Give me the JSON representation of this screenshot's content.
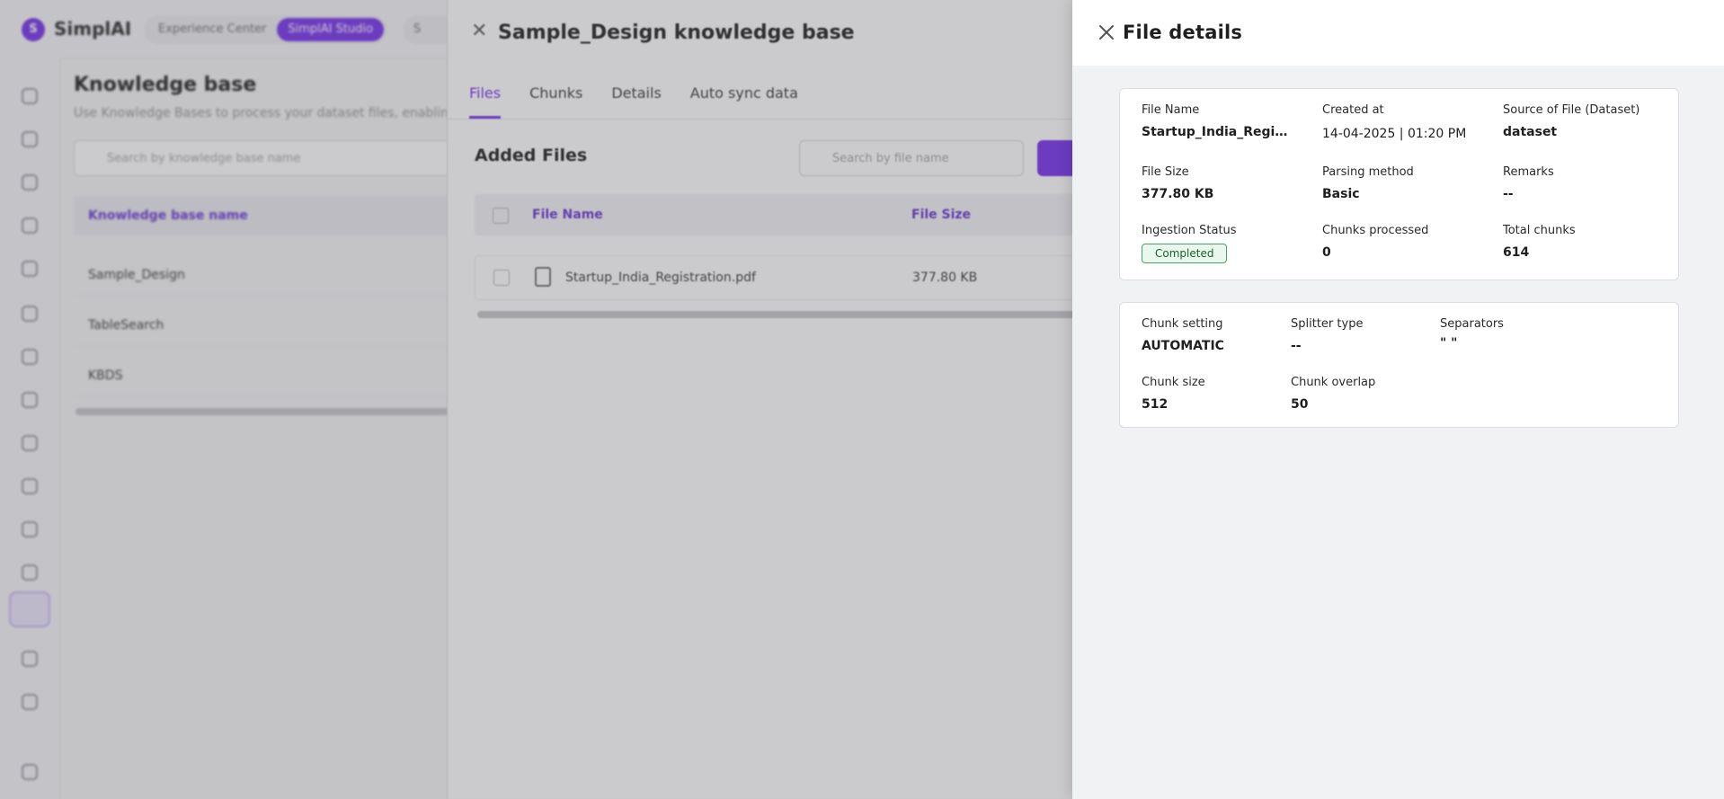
{
  "app": {
    "name": "SimplAI",
    "logo_letter": "S",
    "mode_tabs": [
      "Experience Center",
      "SimplAI Studio"
    ],
    "top_extra": "S"
  },
  "knowledge_base": {
    "title": "Knowledge base",
    "subtitle": "Use Knowledge Bases to process your dataset files, enabling sem",
    "search_placeholder": "Search by knowledge base name",
    "column_header": "Knowledge base name",
    "rows": [
      "Sample_Design",
      "TableSearch",
      "KBDS"
    ]
  },
  "kb_drawer": {
    "title": "Sample_Design knowledge base",
    "tabs": [
      "Files",
      "Chunks",
      "Details",
      "Auto sync data"
    ],
    "active_tab": "Files",
    "section_title": "Added Files",
    "search_placeholder": "Search by file name",
    "columns": [
      "File Name",
      "File Size"
    ],
    "files": [
      {
        "name": "Startup_India_Registration.pdf",
        "size": "377.80 KB"
      }
    ]
  },
  "file_details": {
    "title": "File details",
    "info": {
      "file_name_label": "File Name",
      "file_name": "Startup_India_Registrat...",
      "created_at_label": "Created at",
      "created_at": "14-04-2025 | 01:20 PM",
      "source_label": "Source of File (Dataset)",
      "source": "dataset",
      "file_size_label": "File Size",
      "file_size": "377.80 KB",
      "parsing_method_label": "Parsing method",
      "parsing_method": "Basic",
      "remarks_label": "Remarks",
      "remarks": "--",
      "ingestion_status_label": "Ingestion Status",
      "ingestion_status": "Completed",
      "chunks_processed_label": "Chunks processed",
      "chunks_processed": "0",
      "total_chunks_label": "Total chunks",
      "total_chunks": "614"
    },
    "chunking": {
      "chunk_setting_label": "Chunk setting",
      "chunk_setting": "AUTOMATIC",
      "splitter_type_label": "Splitter type",
      "splitter_type": "--",
      "separators_label": "Separators",
      "separators": "\" \"",
      "chunk_size_label": "Chunk size",
      "chunk_size": "512",
      "chunk_overlap_label": "Chunk overlap",
      "chunk_overlap": "50"
    }
  },
  "colors": {
    "accent": "#7c3aed",
    "status_success_bg": "#e9f7ec",
    "status_success_border": "#47a55d"
  }
}
